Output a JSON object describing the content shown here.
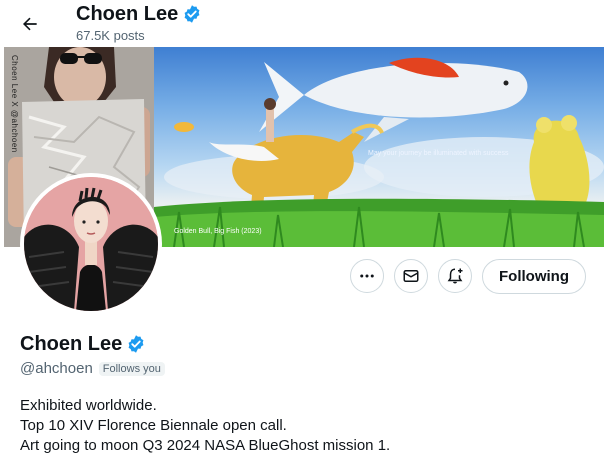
{
  "header": {
    "back_icon": "arrow-left-icon",
    "name": "Choen Lee",
    "post_count": "67.5K posts",
    "verified_icon": "verified-badge-icon"
  },
  "banner": {
    "vertical_text": "Choen Lee X @ahchoen",
    "caption": "Golden Bull, Big Fish (2023)",
    "slogan": "May your journey be illuminated with success"
  },
  "actions": {
    "more_icon": "more-icon",
    "message_icon": "envelope-icon",
    "notify_icon": "bell-plus-icon",
    "follow_label": "Following"
  },
  "profile": {
    "name": "Choen Lee",
    "handle": "@ahchoen",
    "follows_you": "Follows you",
    "bio": [
      "Exhibited worldwide.",
      "Top 10 XIV Florence Biennale open call.",
      "Art going to moon Q3 2024 NASA BlueGhost mission 1."
    ]
  },
  "colors": {
    "verified": "#1d9bf0",
    "muted_text": "#536471",
    "border": "#cfd9de",
    "avatar_bg": "#e5a4a4"
  }
}
